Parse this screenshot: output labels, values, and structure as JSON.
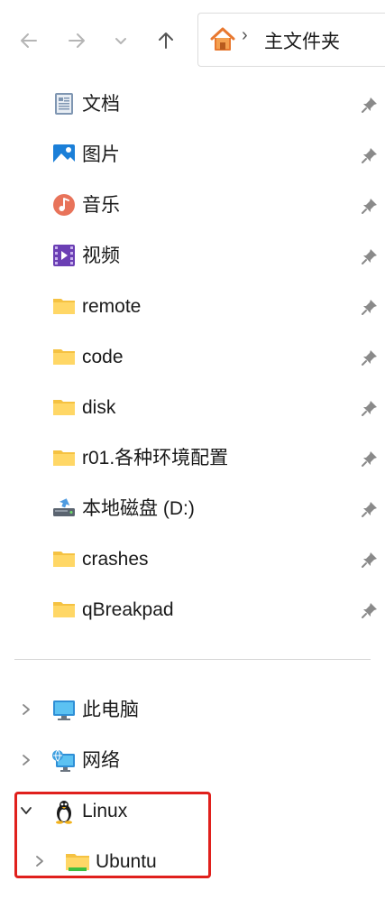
{
  "toolbar": {
    "back_icon": "arrow-left-icon",
    "forward_icon": "arrow-right-icon",
    "recent_icon": "chevron-down-icon",
    "up_icon": "arrow-up-icon"
  },
  "address": {
    "home_icon": "home-icon",
    "separator": "›",
    "path": "主文件夹"
  },
  "quick_access": [
    {
      "label": "文档",
      "icon": "documents-icon"
    },
    {
      "label": "图片",
      "icon": "pictures-icon"
    },
    {
      "label": "音乐",
      "icon": "music-icon"
    },
    {
      "label": "视频",
      "icon": "videos-icon"
    },
    {
      "label": "remote",
      "icon": "folder-icon"
    },
    {
      "label": "code",
      "icon": "folder-icon"
    },
    {
      "label": "disk",
      "icon": "folder-icon"
    },
    {
      "label": "r01.各种环境配置",
      "icon": "folder-icon"
    },
    {
      "label": "本地磁盘 (D:)",
      "icon": "drive-icon"
    },
    {
      "label": "crashes",
      "icon": "folder-icon"
    },
    {
      "label": "qBreakpad",
      "icon": "folder-icon"
    }
  ],
  "tree": [
    {
      "label": "此电脑",
      "icon": "computer-icon",
      "expanded": false
    },
    {
      "label": "网络",
      "icon": "network-icon",
      "expanded": false
    },
    {
      "label": "Linux",
      "icon": "linux-tux-icon",
      "expanded": true
    },
    {
      "label": "Ubuntu",
      "icon": "folder-icon",
      "expanded": false
    }
  ],
  "colors": {
    "folder": "#FFD766",
    "folder_dark": "#F5C242",
    "highlight": "#E0201C",
    "pin": "#7a7a7a",
    "chevron": "#8a8a8a"
  }
}
